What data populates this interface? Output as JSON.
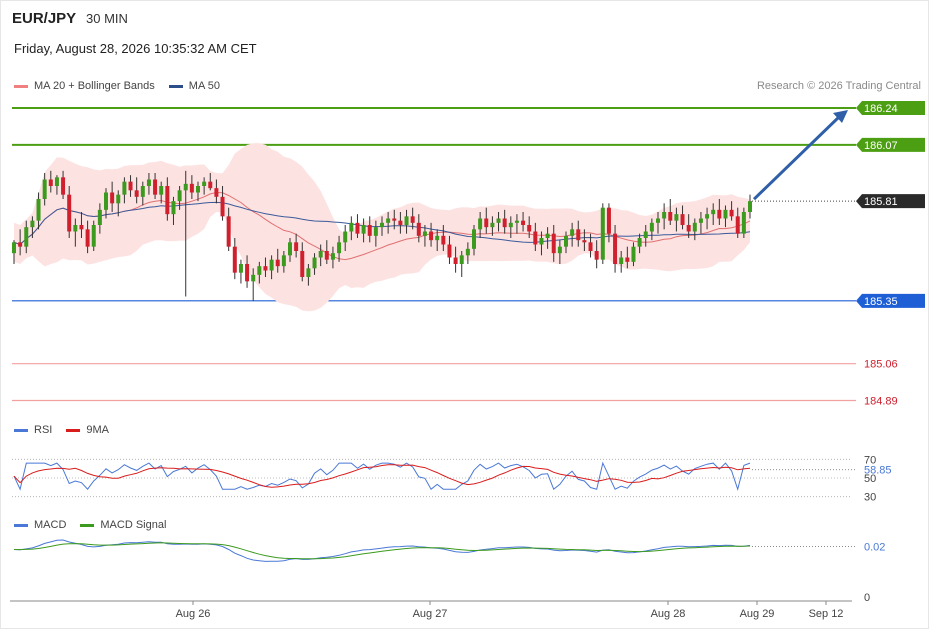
{
  "header": {
    "symbol": "EUR/JPY",
    "timeframe": "30 MIN",
    "datetime": "Friday, August 28, 2026 10:35:32 AM CET",
    "credit": "Research © 2026 Trading Central"
  },
  "price_legend": [
    {
      "label": "MA 20 + Bollinger Bands",
      "color": "#f08080"
    },
    {
      "label": "MA 50",
      "color": "#2c4f8a"
    }
  ],
  "rsi_legend": [
    {
      "label": "RSI",
      "color": "#4a78d6"
    },
    {
      "label": "9MA",
      "color": "#d91c1c"
    }
  ],
  "macd_legend": [
    {
      "label": "MACD",
      "color": "#4a78d6"
    },
    {
      "label": "MACD Signal",
      "color": "#3c9a1e"
    }
  ],
  "colors": {
    "up": "#3c9a1e",
    "down": "#d0202e",
    "resistance": "#4c9f12",
    "support": "#1f5fd6",
    "target_line": "#f2a0a0",
    "target_label": "#d0202e",
    "bollinger_fill": "#fde2e2",
    "arrow": "#2f5fa8",
    "current_tag": "#2a2a2a"
  },
  "chart_data": [
    {
      "type": "candlestick",
      "title": "EUR/JPY",
      "timeframe": "30 MIN",
      "x_ticks": [
        "Aug 26",
        "Aug 27",
        "Aug 28",
        "Aug 29",
        "Sep 12"
      ],
      "ylim": [
        184.8,
        186.3
      ],
      "current_price": 185.81,
      "current_price_label": "185.81",
      "levels": [
        {
          "value": 186.24,
          "label": "186.24",
          "kind": "resistance"
        },
        {
          "value": 186.07,
          "label": "186.07",
          "kind": "resistance"
        },
        {
          "value": 185.35,
          "label": "185.35",
          "kind": "support"
        },
        {
          "value": 185.06,
          "label": "185.06",
          "kind": "target"
        },
        {
          "value": 184.89,
          "label": "184.89",
          "kind": "target"
        }
      ],
      "forecast_target": 186.24,
      "candles": [
        [
          185.57,
          185.63,
          185.52,
          185.62
        ],
        [
          185.62,
          185.68,
          185.56,
          185.6
        ],
        [
          185.6,
          185.72,
          185.57,
          185.69
        ],
        [
          185.69,
          185.74,
          185.64,
          185.72
        ],
        [
          185.72,
          185.85,
          185.68,
          185.82
        ],
        [
          185.82,
          185.94,
          185.79,
          185.91
        ],
        [
          185.91,
          185.95,
          185.85,
          185.88
        ],
        [
          185.88,
          185.93,
          185.84,
          185.92
        ],
        [
          185.92,
          185.95,
          185.82,
          185.84
        ],
        [
          185.84,
          185.88,
          185.64,
          185.67
        ],
        [
          185.67,
          185.73,
          185.6,
          185.7
        ],
        [
          185.7,
          185.76,
          185.64,
          185.68
        ],
        [
          185.68,
          185.72,
          185.57,
          185.6
        ],
        [
          185.6,
          185.72,
          185.58,
          185.7
        ],
        [
          185.7,
          185.8,
          185.66,
          185.77
        ],
        [
          185.77,
          185.87,
          185.73,
          185.85
        ],
        [
          185.85,
          185.9,
          185.76,
          185.8
        ],
        [
          185.8,
          185.86,
          185.74,
          185.84
        ],
        [
          185.84,
          185.92,
          185.8,
          185.9
        ],
        [
          185.9,
          185.93,
          185.83,
          185.86
        ],
        [
          185.86,
          185.92,
          185.8,
          185.83
        ],
        [
          185.83,
          185.9,
          185.79,
          185.88
        ],
        [
          185.88,
          185.94,
          185.84,
          185.91
        ],
        [
          185.91,
          185.94,
          185.82,
          185.84
        ],
        [
          185.84,
          185.9,
          185.8,
          185.88
        ],
        [
          185.88,
          185.92,
          185.72,
          185.75
        ],
        [
          185.75,
          185.83,
          185.7,
          185.81
        ],
        [
          185.81,
          185.88,
          185.77,
          185.86
        ],
        [
          185.86,
          185.95,
          185.37,
          185.89
        ],
        [
          185.89,
          185.93,
          185.82,
          185.85
        ],
        [
          185.85,
          185.9,
          185.81,
          185.88
        ],
        [
          185.88,
          185.92,
          185.84,
          185.9
        ],
        [
          185.9,
          185.94,
          185.86,
          185.87
        ],
        [
          185.87,
          185.91,
          185.8,
          185.83
        ],
        [
          185.83,
          185.88,
          185.72,
          185.74
        ],
        [
          185.74,
          185.78,
          185.58,
          185.6
        ],
        [
          185.6,
          185.64,
          185.45,
          185.48
        ],
        [
          185.48,
          185.54,
          185.43,
          185.52
        ],
        [
          185.52,
          185.56,
          185.41,
          185.44
        ],
        [
          185.44,
          185.5,
          185.35,
          185.47
        ],
        [
          185.47,
          185.53,
          185.43,
          185.51
        ],
        [
          185.51,
          185.55,
          185.46,
          185.49
        ],
        [
          185.49,
          185.56,
          185.45,
          185.54
        ],
        [
          185.54,
          185.59,
          185.48,
          185.51
        ],
        [
          185.51,
          185.58,
          185.48,
          185.56
        ],
        [
          185.56,
          185.64,
          185.53,
          185.62
        ],
        [
          185.62,
          185.66,
          185.55,
          185.58
        ],
        [
          185.58,
          185.62,
          185.44,
          185.46
        ],
        [
          185.46,
          185.52,
          185.42,
          185.5
        ],
        [
          185.5,
          185.57,
          185.47,
          185.55
        ],
        [
          185.55,
          185.61,
          185.51,
          185.58
        ],
        [
          185.58,
          185.63,
          185.52,
          185.54
        ],
        [
          185.54,
          185.6,
          185.5,
          185.57
        ],
        [
          185.57,
          185.65,
          185.53,
          185.62
        ],
        [
          185.62,
          185.7,
          185.58,
          185.67
        ],
        [
          185.67,
          185.74,
          185.63,
          185.71
        ],
        [
          185.71,
          185.75,
          185.64,
          185.66
        ],
        [
          185.66,
          185.73,
          185.62,
          185.7
        ],
        [
          185.7,
          185.74,
          185.62,
          185.65
        ],
        [
          185.65,
          185.72,
          185.6,
          185.69
        ],
        [
          185.69,
          185.74,
          185.65,
          185.71
        ],
        [
          185.71,
          185.76,
          185.66,
          185.73
        ],
        [
          185.73,
          185.77,
          185.68,
          185.72
        ],
        [
          185.72,
          185.76,
          185.66,
          185.7
        ],
        [
          185.7,
          185.77,
          185.66,
          185.74
        ],
        [
          185.74,
          185.78,
          185.68,
          185.71
        ],
        [
          185.71,
          185.75,
          185.62,
          185.65
        ],
        [
          185.65,
          185.7,
          185.6,
          185.67
        ],
        [
          185.67,
          185.71,
          185.6,
          185.63
        ],
        [
          185.63,
          185.68,
          185.58,
          185.65
        ],
        [
          185.65,
          185.7,
          185.58,
          185.61
        ],
        [
          185.61,
          185.65,
          185.52,
          185.55
        ],
        [
          185.55,
          185.6,
          185.48,
          185.52
        ],
        [
          185.52,
          185.58,
          185.46,
          185.56
        ],
        [
          185.56,
          185.62,
          185.52,
          185.59
        ],
        [
          185.59,
          185.7,
          185.56,
          185.68
        ],
        [
          185.68,
          185.76,
          185.64,
          185.73
        ],
        [
          185.73,
          185.78,
          185.66,
          185.69
        ],
        [
          185.69,
          185.74,
          185.65,
          185.71
        ],
        [
          185.71,
          185.76,
          185.67,
          185.73
        ],
        [
          185.73,
          185.77,
          185.66,
          185.69
        ],
        [
          185.69,
          185.74,
          185.64,
          185.71
        ],
        [
          185.71,
          185.75,
          185.66,
          185.72
        ],
        [
          185.72,
          185.76,
          185.67,
          185.7
        ],
        [
          185.7,
          185.74,
          185.64,
          185.67
        ],
        [
          185.67,
          185.71,
          185.58,
          185.61
        ],
        [
          185.61,
          185.67,
          185.56,
          185.64
        ],
        [
          185.64,
          185.69,
          185.59,
          185.66
        ],
        [
          185.66,
          185.7,
          185.53,
          185.57
        ],
        [
          185.57,
          185.63,
          185.52,
          185.6
        ],
        [
          185.6,
          185.67,
          185.57,
          185.65
        ],
        [
          185.65,
          185.71,
          185.6,
          185.68
        ],
        [
          185.68,
          185.72,
          185.6,
          185.63
        ],
        [
          185.63,
          185.68,
          185.58,
          185.62
        ],
        [
          185.62,
          185.66,
          185.55,
          185.58
        ],
        [
          185.58,
          185.63,
          185.5,
          185.54
        ],
        [
          185.54,
          185.8,
          185.52,
          185.78
        ],
        [
          185.78,
          185.8,
          185.62,
          185.66
        ],
        [
          185.66,
          185.7,
          185.48,
          185.52
        ],
        [
          185.52,
          185.58,
          185.48,
          185.55
        ],
        [
          185.55,
          185.6,
          185.5,
          185.53
        ],
        [
          185.53,
          185.62,
          185.51,
          185.6
        ],
        [
          185.6,
          185.66,
          185.57,
          185.64
        ],
        [
          185.64,
          185.7,
          185.6,
          185.67
        ],
        [
          185.67,
          185.73,
          185.63,
          185.71
        ],
        [
          185.71,
          185.76,
          185.66,
          185.73
        ],
        [
          185.73,
          185.8,
          185.68,
          185.76
        ],
        [
          185.76,
          185.82,
          185.7,
          185.72
        ],
        [
          185.72,
          185.78,
          185.67,
          185.75
        ],
        [
          185.75,
          185.79,
          185.68,
          185.7
        ],
        [
          185.7,
          185.75,
          185.64,
          185.67
        ],
        [
          185.67,
          185.73,
          185.63,
          185.71
        ],
        [
          185.71,
          185.76,
          185.66,
          185.73
        ],
        [
          185.73,
          185.78,
          185.68,
          185.75
        ],
        [
          185.75,
          185.8,
          185.7,
          185.77
        ],
        [
          185.77,
          185.82,
          185.7,
          185.73
        ],
        [
          185.73,
          185.79,
          185.69,
          185.77
        ],
        [
          185.77,
          185.81,
          185.72,
          185.74
        ],
        [
          185.74,
          185.78,
          185.64,
          185.66
        ],
        [
          185.66,
          185.78,
          185.64,
          185.76
        ],
        [
          185.76,
          185.84,
          185.73,
          185.81
        ]
      ]
    },
    {
      "type": "line",
      "title": "RSI",
      "series": [
        {
          "name": "RSI"
        },
        {
          "name": "9MA"
        }
      ],
      "y_ticks": [
        70,
        50,
        30
      ],
      "ylim": [
        20,
        80
      ],
      "current_value": 58.85,
      "current_label": "58.85",
      "overlapping_tick_label": "50"
    },
    {
      "type": "line",
      "title": "MACD",
      "series": [
        {
          "name": "MACD"
        },
        {
          "name": "MACD Signal"
        }
      ],
      "y_ticks": [
        0.02,
        0
      ],
      "current_value": 0.02,
      "current_label": "0.02",
      "ylim": [
        -0.32,
        0.1
      ]
    }
  ]
}
